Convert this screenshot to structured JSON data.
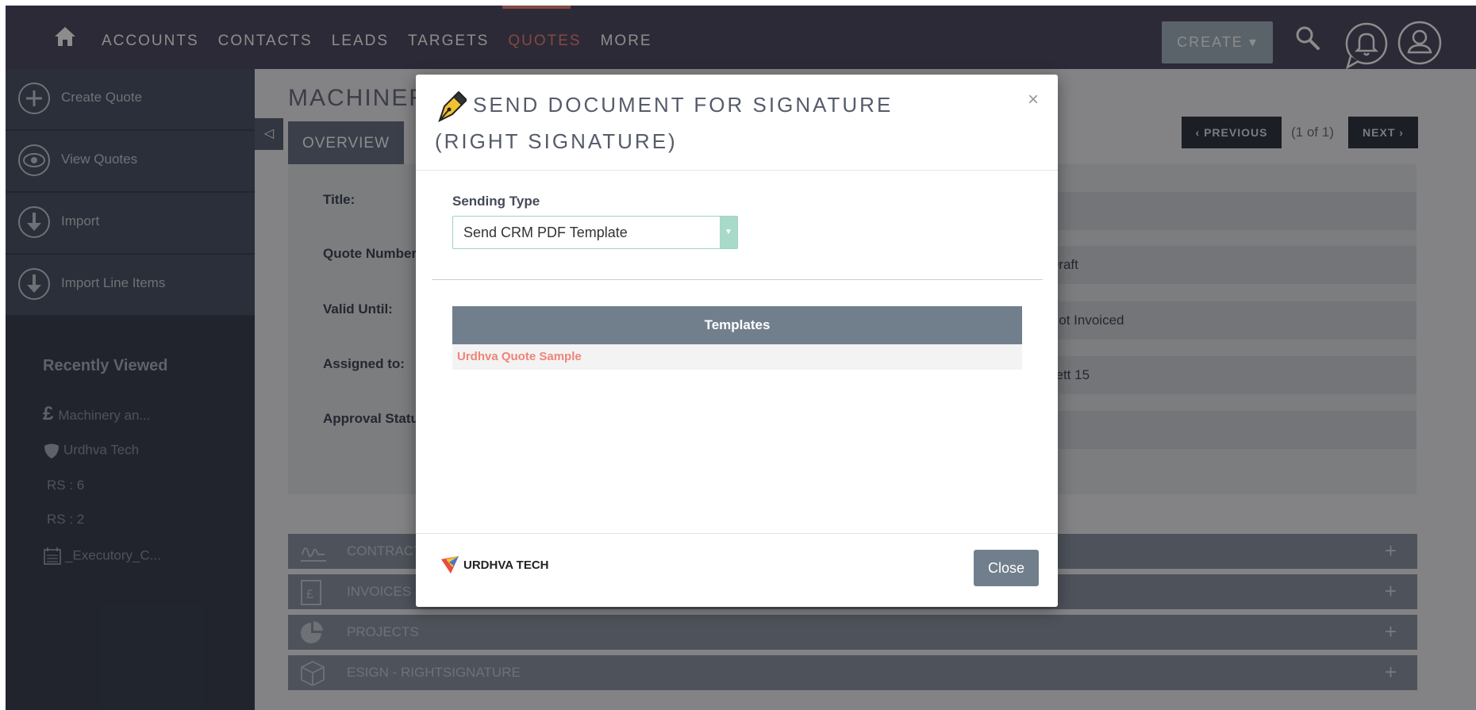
{
  "nav": {
    "items": [
      {
        "label": "ACCOUNTS",
        "active": false
      },
      {
        "label": "CONTACTS",
        "active": false
      },
      {
        "label": "LEADS",
        "active": false
      },
      {
        "label": "TARGETS",
        "active": false
      },
      {
        "label": "QUOTES",
        "active": true
      },
      {
        "label": "MORE",
        "active": false
      }
    ],
    "create_label": "CREATE ▾",
    "accent_color": "#f08377",
    "bar_color": "#534d64"
  },
  "sidebar": {
    "actions": [
      {
        "label": "Create Quote",
        "icon": "plus-circle-icon"
      },
      {
        "label": "View Quotes",
        "icon": "eye-icon"
      },
      {
        "label": "Import",
        "icon": "download-icon"
      },
      {
        "label": "Import Line Items",
        "icon": "download-icon"
      }
    ],
    "recently_viewed_title": "Recently Viewed",
    "recent": [
      {
        "label": "Machinery an...",
        "icon": "pound-icon"
      },
      {
        "label": "Urdhva Tech",
        "icon": "shield-icon"
      },
      {
        "label": "RS : 6",
        "icon": ""
      },
      {
        "label": "RS : 2",
        "icon": ""
      },
      {
        "label": "_Executory_C...",
        "icon": "calendar-icon"
      }
    ]
  },
  "main": {
    "record_title": "MACHINERY",
    "overview_tab": "OVERVIEW",
    "pager": {
      "prev": "‹ PREVIOUS",
      "count": "(1 of 1)",
      "next": "NEXT ›"
    },
    "fields": [
      "Title:",
      "Quote Number:",
      "Valid Until:",
      "Assigned to:",
      "Approval Status:"
    ],
    "right_values": [
      "",
      "Draft",
      "Not Invoiced",
      "Jett 15",
      ""
    ],
    "subpanels": [
      {
        "label": "CONTRACTS",
        "icon": "signature-icon"
      },
      {
        "label": "INVOICES",
        "icon": "invoice-icon"
      },
      {
        "label": "PROJECTS",
        "icon": "pie-chart-icon"
      },
      {
        "label": "ESIGN - RIGHTSIGNATURE",
        "icon": "cube-icon"
      }
    ]
  },
  "modal": {
    "title": "SEND DOCUMENT FOR SIGNATURE (RIGHT SIGNATURE)",
    "close_x": "×",
    "sending_type_label": "Sending Type",
    "sending_type_value": "Send CRM PDF Template",
    "templates_header": "Templates",
    "templates": [
      "Urdhva Quote Sample"
    ],
    "logo_text": "URDHVA TECH",
    "close_button": "Close"
  }
}
